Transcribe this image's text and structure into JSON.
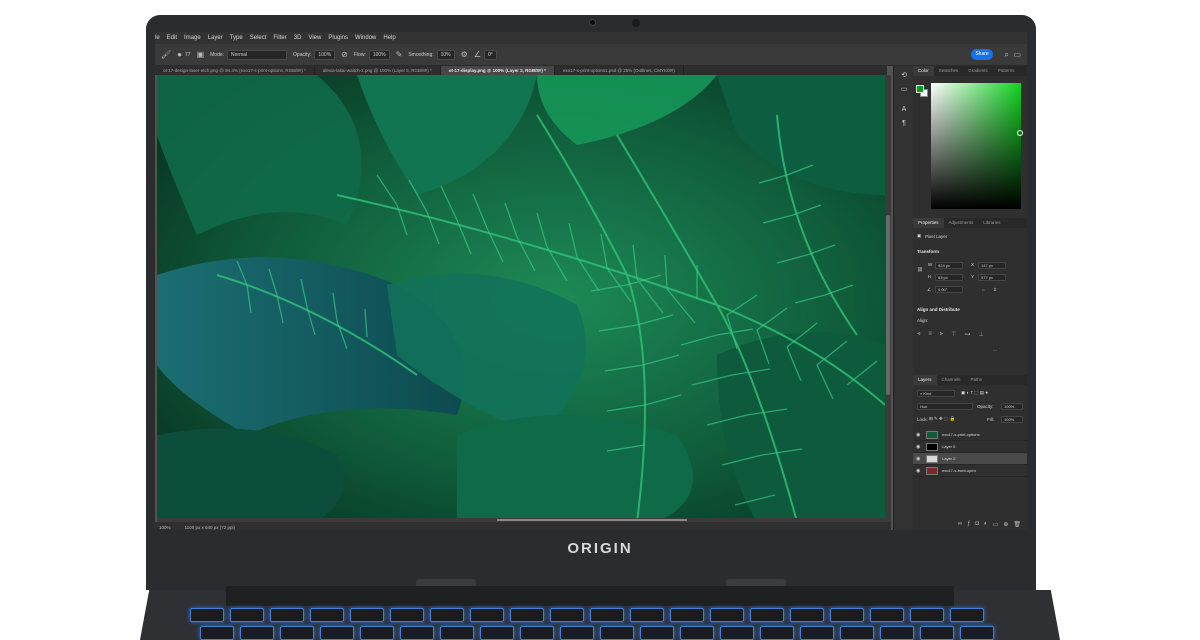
{
  "menubar": {
    "items": [
      "le",
      "Edit",
      "Image",
      "Layer",
      "Type",
      "Select",
      "Filter",
      "3D",
      "View",
      "Plugins",
      "Window",
      "Help"
    ]
  },
  "options": {
    "brush_size": "77",
    "mode_label": "Mode:",
    "mode_value": "Normal",
    "opacity_label": "Opacity:",
    "opacity_value": "100%",
    "flow_label": "Flow:",
    "flow_value": "100%",
    "smoothing_label": "Smoothing:",
    "smoothing_value": "10%",
    "angle_value": "0°",
    "share_label": "Share"
  },
  "tabs": [
    "ot-17-design-laser-etch.png @ 94.4% (exo17-s-print-options, RGB/8#) *",
    "alexia-lakai-waitch-2.png @ 100% (Layer 5, RGB/8#) *",
    "ot-17-display.png @ 100% (Layer 2, RGB/8#) *",
    "exo17-s-print-options1.psd @ 25% (Outlines, CMYK/8#)"
  ],
  "active_tab_index": 2,
  "status": {
    "zoom": "100%",
    "doc_size": "1100 px x 640 px (72 ppi)"
  },
  "color_panel": {
    "tabs": [
      "Color",
      "Swatches",
      "Gradients",
      "Patterns"
    ],
    "foreground": "#0e9a1a",
    "background": "#ffffff"
  },
  "properties_panel": {
    "tabs": [
      "Properties",
      "Adjustments",
      "Libraries"
    ],
    "layer_type": "Pixel Layer",
    "transform_title": "Transform",
    "w_label": "W",
    "w_value": "924 px",
    "h_label": "H",
    "h_value": "63 px",
    "x_label": "X",
    "x_value": "147 px",
    "y_label": "Y",
    "y_value": "577 px",
    "angle_value": "0.00°",
    "align_title": "Align and Distribute",
    "align_label": "Align:",
    "more": "..."
  },
  "layers_panel": {
    "tabs": [
      "Layers",
      "Channels",
      "Paths"
    ],
    "kind_label": "Kind",
    "blend_value": "Hue",
    "opacity_label": "Opacity:",
    "opacity_value": "100%",
    "lock_label": "Lock:",
    "fill_label": "Fill:",
    "fill_value": "100%",
    "layers": [
      {
        "name": "exo17-s-print-options",
        "selected": false
      },
      {
        "name": "Layer 5",
        "selected": false
      },
      {
        "name": "Layer 2",
        "selected": true
      },
      {
        "name": "exo17-s-front-open",
        "selected": false
      }
    ]
  },
  "device": {
    "brand": "ORIGIN"
  },
  "colors": {
    "accent": "#1473e6",
    "keyboard_glow": "#3d7ed6"
  }
}
